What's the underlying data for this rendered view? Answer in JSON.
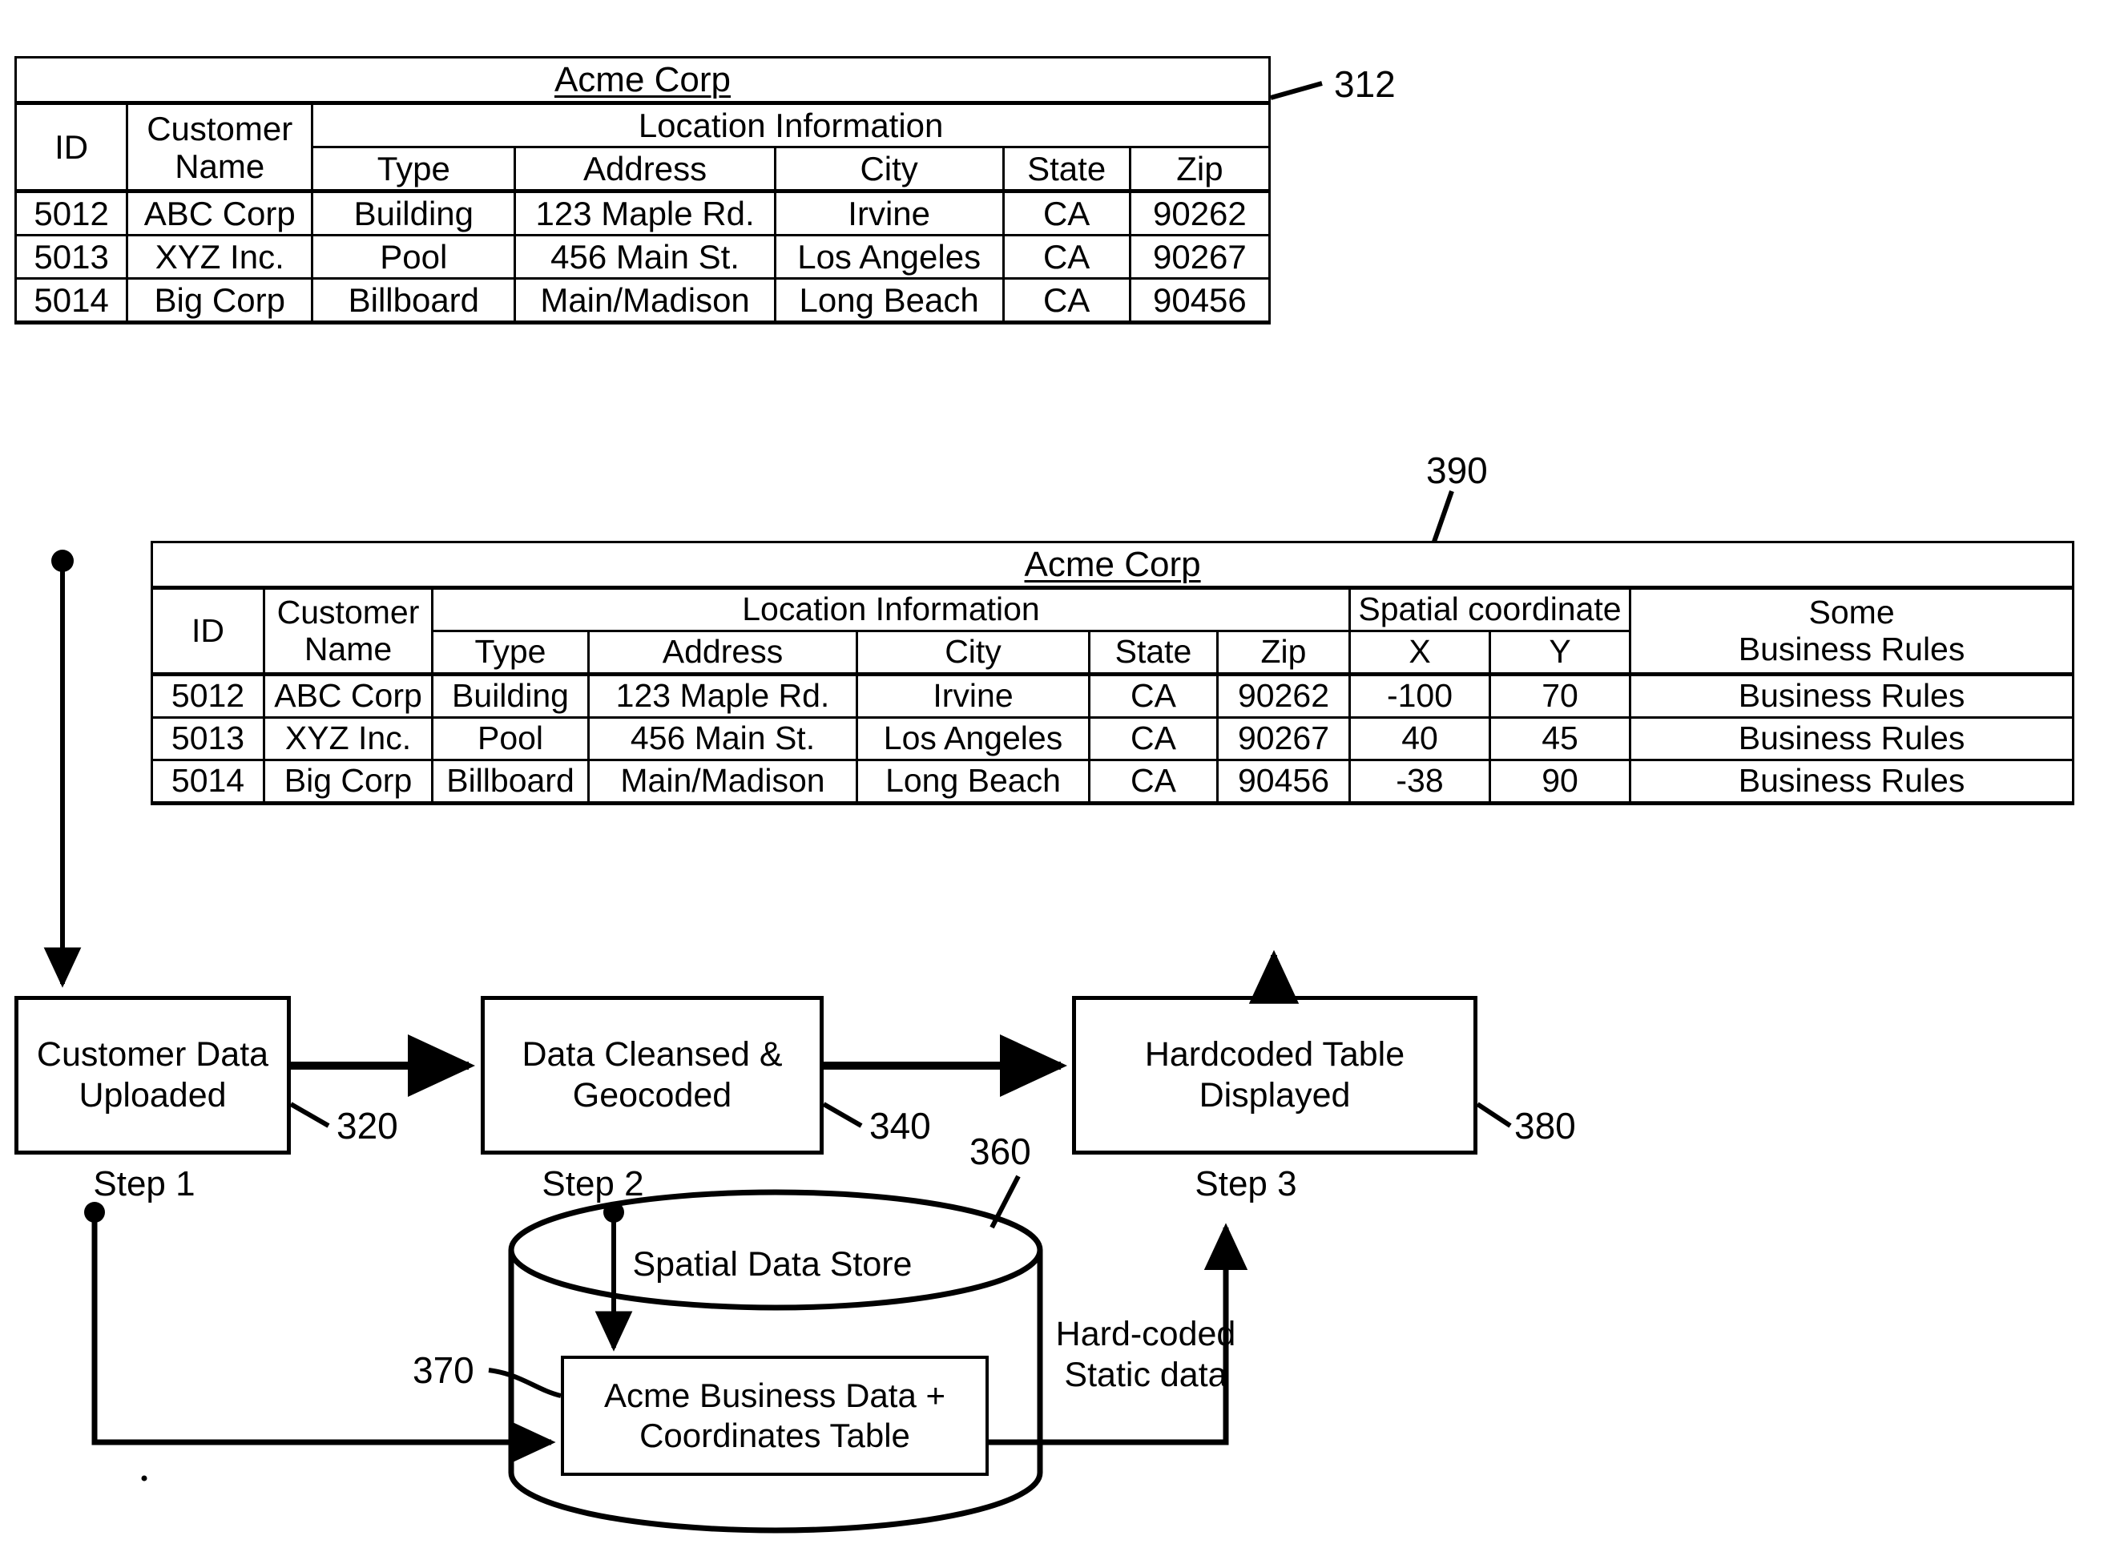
{
  "figure": {
    "reference_numbers": {
      "table_top": "312",
      "table_bottom": "390",
      "step1_box": "320",
      "step2_box": "340",
      "step3_box": "380",
      "data_store": "360",
      "inner_table": "370"
    }
  },
  "table_312": {
    "title": "Acme Corp",
    "group_headers": {
      "id": "ID",
      "customer_name": "Customer\nName",
      "location_information": "Location Information"
    },
    "sub_headers": [
      "Type",
      "Address",
      "City",
      "State",
      "Zip"
    ],
    "rows": [
      {
        "id": "5012",
        "customer_name": "ABC Corp",
        "type": "Building",
        "address": "123 Maple Rd.",
        "city": "Irvine",
        "state": "CA",
        "zip": "90262"
      },
      {
        "id": "5013",
        "customer_name": "XYZ Inc.",
        "type": "Pool",
        "address": "456 Main St.",
        "city": "Los Angeles",
        "state": "CA",
        "zip": "90267"
      },
      {
        "id": "5014",
        "customer_name": "Big Corp",
        "type": "Billboard",
        "address": "Main/Madison",
        "city": "Long Beach",
        "state": "CA",
        "zip": "90456"
      }
    ]
  },
  "table_390": {
    "title": "Acme Corp",
    "group_headers": {
      "id": "ID",
      "customer_name": "Customer\nName",
      "location_information": "Location Information",
      "spatial_coordinate": "Spatial coordinate",
      "business_rules": "Some\nBusiness Rules"
    },
    "sub_headers": [
      "Type",
      "Address",
      "City",
      "State",
      "Zip",
      "X",
      "Y"
    ],
    "rows": [
      {
        "id": "5012",
        "customer_name": "ABC Corp",
        "type": "Building",
        "address": "123 Maple Rd.",
        "city": "Irvine",
        "state": "CA",
        "zip": "90262",
        "x": "-100",
        "y": "70",
        "rules": "Business Rules"
      },
      {
        "id": "5013",
        "customer_name": "XYZ Inc.",
        "type": "Pool",
        "address": "456 Main St.",
        "city": "Los Angeles",
        "state": "CA",
        "zip": "90267",
        "x": "40",
        "y": "45",
        "rules": "Business Rules"
      },
      {
        "id": "5014",
        "customer_name": "Big Corp",
        "type": "Billboard",
        "address": "Main/Madison",
        "city": "Long Beach",
        "state": "CA",
        "zip": "90456",
        "x": "-38",
        "y": "90",
        "rules": "Business Rules"
      }
    ]
  },
  "flow": {
    "box1": "Customer Data\nUploaded",
    "box2": "Data Cleansed &\nGeocoded",
    "box3": "Hardcoded Table\nDisplayed",
    "step1": "Step 1",
    "step2": "Step 2",
    "step3": "Step 3",
    "data_store_label": "Spatial Data Store",
    "inner_table_label": "Acme Business Data +\nCoordinates Table",
    "hardcoded_edge_label": "Hard-coded\nStatic data"
  },
  "colors": {
    "line": "#000000",
    "background": "#ffffff"
  }
}
